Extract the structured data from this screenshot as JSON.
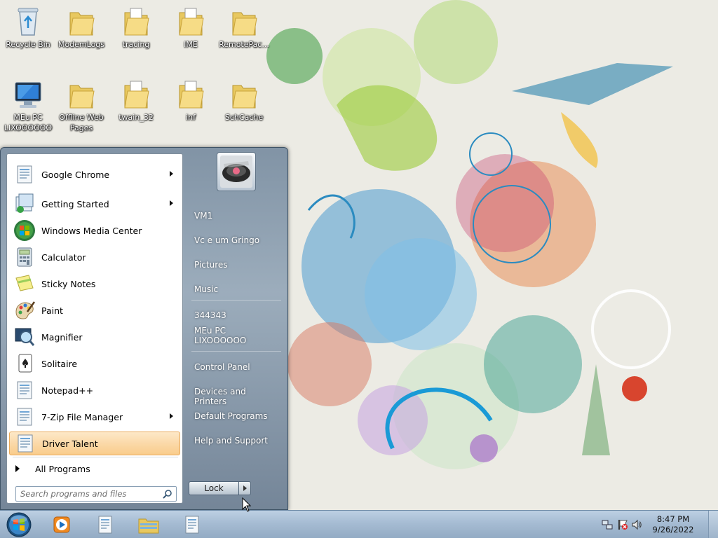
{
  "desktop": {
    "icons": [
      {
        "label": "Recycle Bin",
        "icon": "recycle-bin-icon"
      },
      {
        "label": "ModemLogs",
        "icon": "folder-icon"
      },
      {
        "label": "tracing",
        "icon": "folder-icon"
      },
      {
        "label": "IME",
        "icon": "folder-icon"
      },
      {
        "label": "RemotePac...",
        "icon": "folder-icon"
      },
      {
        "label": "MEu PC LIXOOOOOO",
        "icon": "computer-icon"
      },
      {
        "label": "Offline Web Pages",
        "icon": "folder-icon"
      },
      {
        "label": "twain_32",
        "icon": "folder-icon"
      },
      {
        "label": "inf",
        "icon": "folder-icon"
      },
      {
        "label": "SchCache",
        "icon": "folder-icon"
      }
    ]
  },
  "start_menu": {
    "programs": [
      {
        "label": "Google Chrome",
        "icon": "generic-app-icon",
        "submenu": true
      },
      {
        "label": "Getting Started",
        "icon": "getting-started-icon",
        "submenu": true
      },
      {
        "label": "Windows Media Center",
        "icon": "windows-media-center-icon",
        "submenu": false
      },
      {
        "label": "Calculator",
        "icon": "calculator-icon",
        "submenu": false
      },
      {
        "label": "Sticky Notes",
        "icon": "sticky-notes-icon",
        "submenu": false
      },
      {
        "label": "Paint",
        "icon": "paint-icon",
        "submenu": false
      },
      {
        "label": "Magnifier",
        "icon": "magnifier-icon",
        "submenu": false
      },
      {
        "label": "Solitaire",
        "icon": "solitaire-icon",
        "submenu": false
      },
      {
        "label": "Notepad++",
        "icon": "generic-app-icon",
        "submenu": false
      },
      {
        "label": "7-Zip File Manager",
        "icon": "generic-app-icon",
        "submenu": true
      },
      {
        "label": "Driver Talent",
        "icon": "generic-app-icon",
        "submenu": false,
        "highlighted": true
      }
    ],
    "all_programs_label": "All Programs",
    "search_placeholder": "Search programs and files",
    "right_pane": {
      "items_group1": [
        "VM1",
        "Vc e um Gringo",
        "Pictures",
        "Music"
      ],
      "items_group2": [
        "344343",
        "MEu PC LIXOOOOOO"
      ],
      "items_group3": [
        "Control Panel",
        "Devices and Printers",
        "Default Programs",
        "Help and Support"
      ]
    },
    "lock_label": "Lock"
  },
  "taskbar": {
    "pinned": [
      "windows-media-player-icon",
      "document-icon",
      "explorer-icon",
      "document-icon"
    ],
    "clock_time": "8:47 PM",
    "clock_date": "9/26/2022",
    "tray": [
      "network-icon",
      "action-center-flag-icon",
      "volume-icon"
    ]
  },
  "colors": {
    "highlight": "#f9cc8c",
    "taskbar": "#a6bcd3",
    "wallpaper_bg": "#ecebe4"
  }
}
